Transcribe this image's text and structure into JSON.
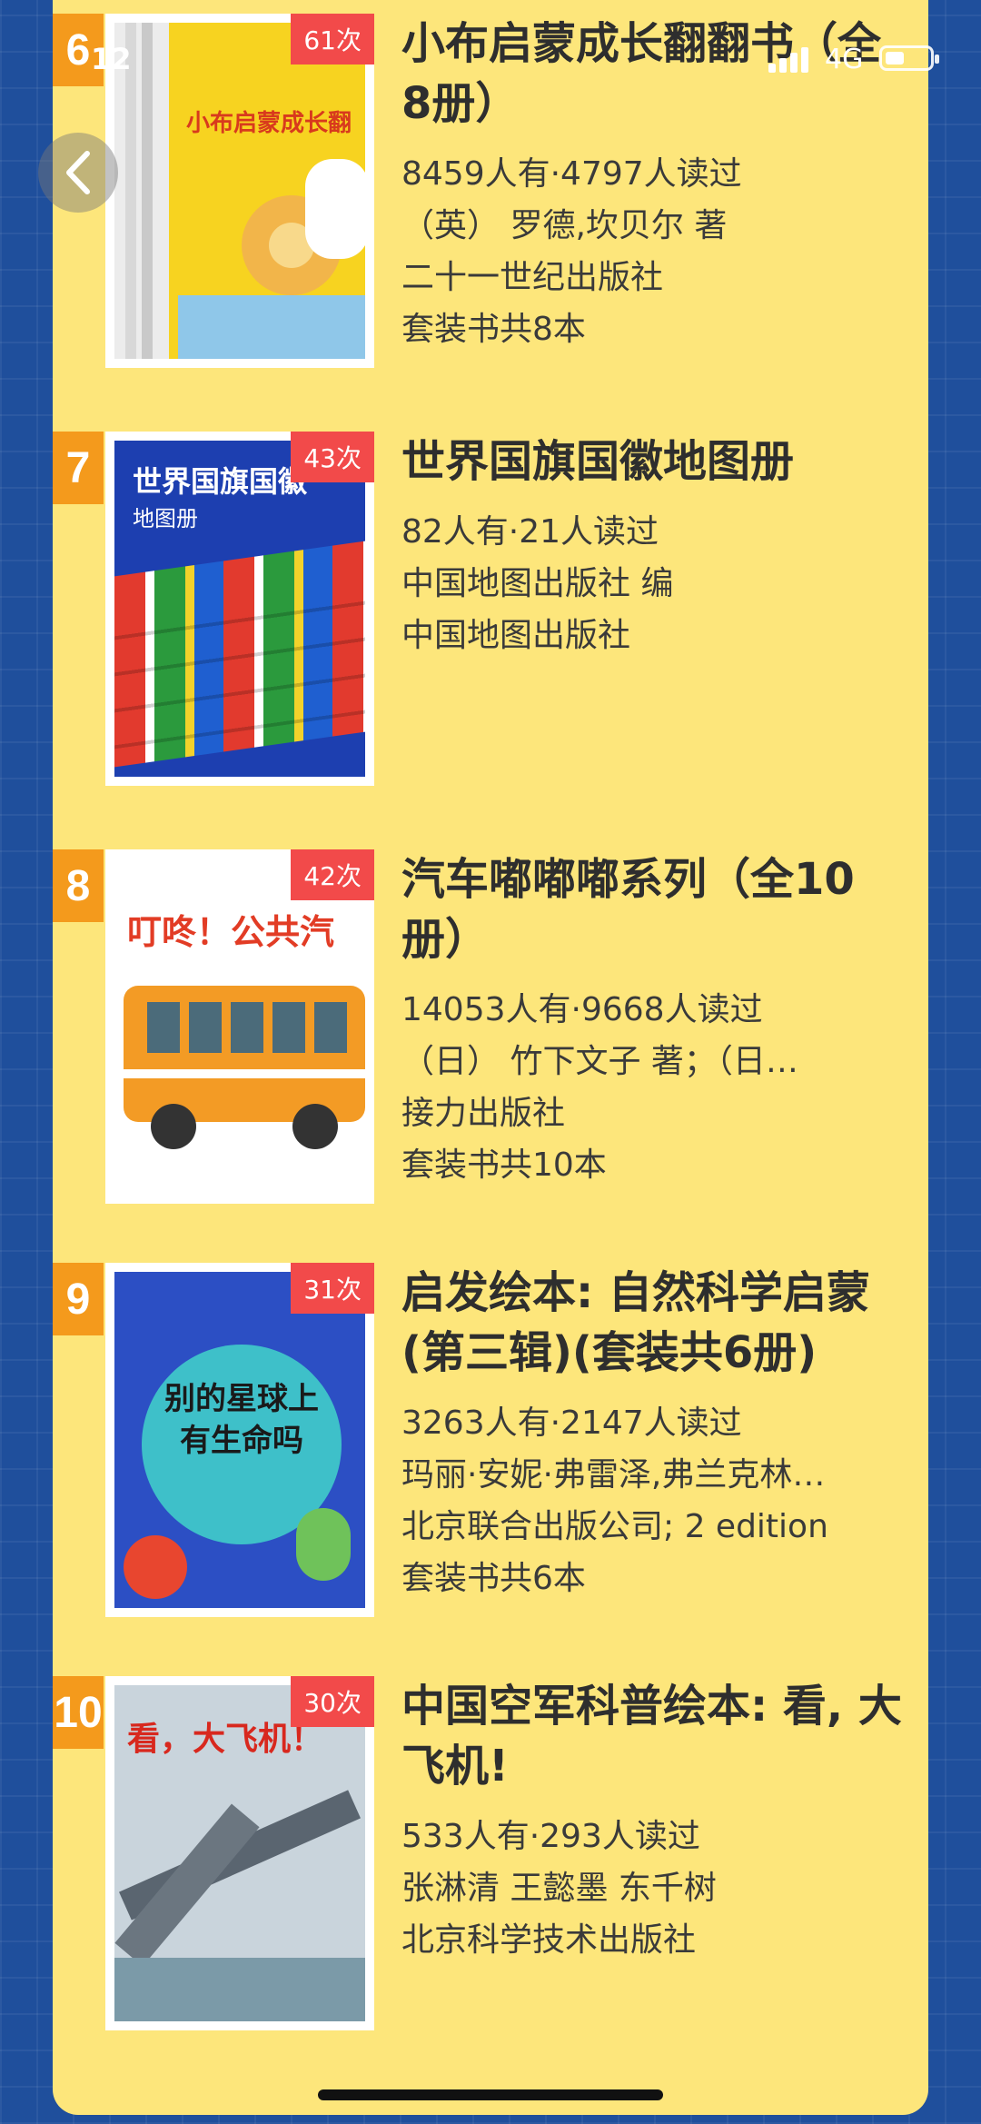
{
  "status_bar": {
    "time": "12",
    "network": "4G"
  },
  "books": [
    {
      "rank": "6",
      "count": "61次",
      "title": "小布启蒙成长翻翻书（全8册）",
      "stats": "8459人有·4797人读过",
      "author": "（英） 罗德,坎贝尔 著",
      "publisher": "二十一世纪出版社",
      "set_info": "套装书共8本",
      "cover_title": "小布启蒙成长翻"
    },
    {
      "rank": "7",
      "count": "43次",
      "title": "世界国旗国徽地图册",
      "stats": "82人有·21人读过",
      "author": "中国地图出版社 编",
      "publisher": "中国地图出版社",
      "set_info": "",
      "cover_title": "世界国旗国徽",
      "cover_subtitle": "地图册"
    },
    {
      "rank": "8",
      "count": "42次",
      "title": "汽车嘟嘟嘟系列（全10册）",
      "stats": "14053人有·9668人读过",
      "author": "（日） 竹下文子 著；（日…",
      "publisher": "接力出版社",
      "set_info": "套装书共10本",
      "cover_title": "叮咚！公共汽"
    },
    {
      "rank": "9",
      "count": "31次",
      "title": "启发绘本: 自然科学启蒙(第三辑)(套装共6册)",
      "stats": "3263人有·2147人读过",
      "author": "玛丽·安妮·弗雷泽,弗兰克林…",
      "publisher": "北京联合出版公司; 2 edition",
      "set_info": "套装书共6本",
      "cover_title": "别的星球上",
      "cover_subtitle": "有生命吗"
    },
    {
      "rank": "10",
      "count": "30次",
      "title": "中国空军科普绘本: 看, 大飞机!",
      "stats": "533人有·293人读过",
      "author": "张淋清 王懿墨 东千树",
      "publisher": "北京科学技术出版社",
      "set_info": "",
      "cover_title": "看，大飞机！"
    }
  ]
}
